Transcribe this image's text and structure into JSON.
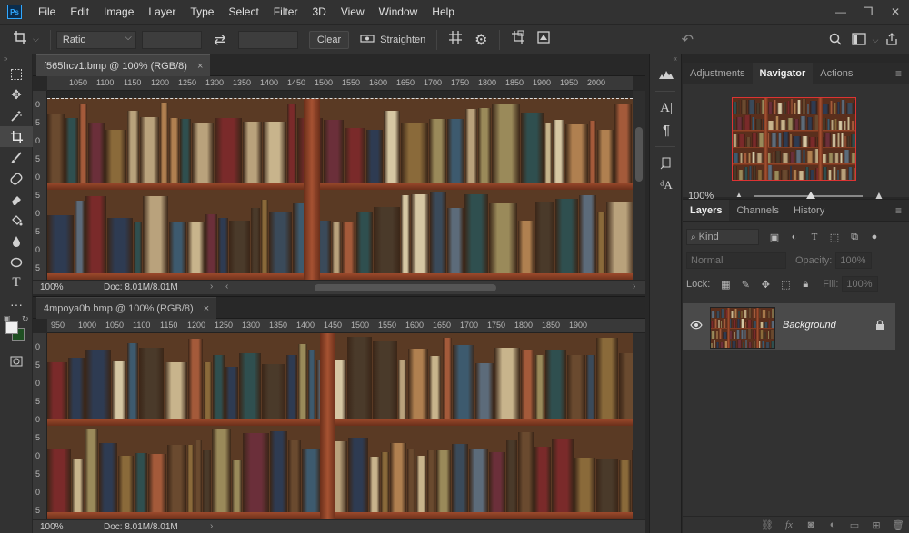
{
  "app": {
    "logo": "Ps",
    "menu": [
      "File",
      "Edit",
      "Image",
      "Layer",
      "Type",
      "Select",
      "Filter",
      "3D",
      "View",
      "Window",
      "Help"
    ],
    "window_controls": [
      "—",
      "❐",
      "✕"
    ]
  },
  "options_bar": {
    "crop_tool_icon": "crop-icon",
    "ratio_select": "Ratio",
    "swap_icon": "swap-icon",
    "clear_button": "Clear",
    "straighten_label": "Straighten",
    "icons": [
      "grid-overlay-icon",
      "gear-icon",
      "delete-cropped-icon",
      "content-aware-icon"
    ],
    "reset_icon": "reset-icon",
    "right_icons": [
      "search-icon",
      "workspace-icon",
      "share-icon"
    ]
  },
  "toolbar": {
    "tools": [
      "marquee-tool-icon",
      "move-tool-icon",
      "magic-wand-icon",
      "crop-tool-icon",
      "brush-icon",
      "healing-brush-icon",
      "eraser-icon",
      "paint-bucket-icon",
      "blur-icon",
      "dodge-icon",
      "text-tool-icon",
      "more-tools-icon"
    ],
    "active_tool_index": 3,
    "foreground_color": "#f0f0f0",
    "background_color": "#1f4f22"
  },
  "documents": [
    {
      "tab_title": "f565hcv1.bmp @ 100% (RGB/8)",
      "close": "×",
      "ruler_labels": [
        "1050",
        "1100",
        "1150",
        "1200",
        "1250",
        "1300",
        "1350",
        "1400",
        "1450",
        "1500",
        "1550",
        "1600",
        "1650",
        "1700",
        "1750",
        "1800",
        "1850",
        "1900",
        "1950",
        "2000"
      ],
      "vruler_labels": [
        "0",
        "5",
        "0",
        "5",
        "0",
        "5",
        "0",
        "5",
        "0",
        "5"
      ],
      "zoom": "100%",
      "doc_info": "Doc: 8.01M/8.01M"
    },
    {
      "tab_title": "4mpoya0b.bmp @ 100% (RGB/8)",
      "close": "×",
      "ruler_labels": [
        "950",
        "1000",
        "1050",
        "1100",
        "1150",
        "1200",
        "1250",
        "1300",
        "1350",
        "1400",
        "1450",
        "1500",
        "1550",
        "1600",
        "1650",
        "1700",
        "1750",
        "1800",
        "1850",
        "1900"
      ],
      "vruler_labels": [
        "0",
        "5",
        "0",
        "5",
        "0",
        "5",
        "0",
        "5",
        "0",
        "5"
      ],
      "zoom": "100%",
      "doc_info": "Doc: 8.01M/8.01M"
    }
  ],
  "navigator_panel": {
    "tabs": [
      "Adjustments",
      "Navigator",
      "Actions"
    ],
    "active_tab": "Navigator",
    "zoom": "100%"
  },
  "layers_panel": {
    "tabs": [
      "Layers",
      "Channels",
      "History"
    ],
    "active_tab": "Layers",
    "filter_kind": "Kind",
    "blend_mode": "Normal",
    "opacity_label": "Opacity:",
    "opacity_value": "100%",
    "lock_label": "Lock:",
    "fill_label": "Fill:",
    "fill_value": "100%",
    "layer_name": "Background",
    "footer_icons": [
      "link-icon",
      "fx-icon",
      "mask-icon",
      "adjustment-layer-icon",
      "group-icon",
      "new-layer-icon",
      "trash-icon"
    ]
  }
}
